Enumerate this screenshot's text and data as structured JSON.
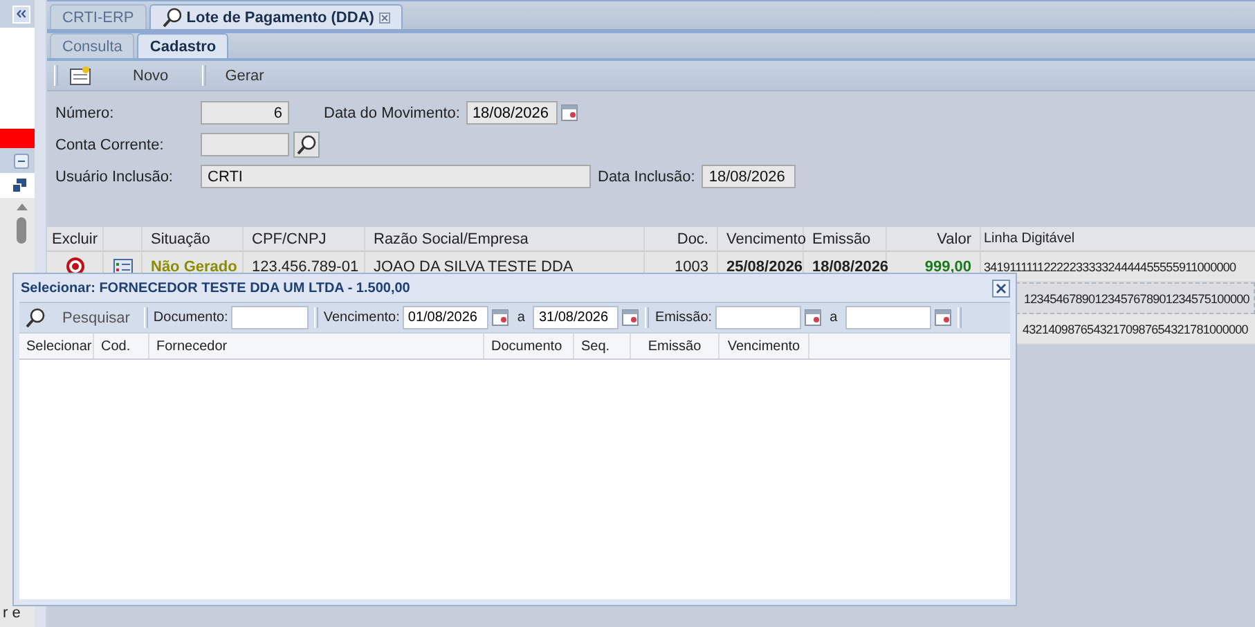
{
  "sidebar": {
    "texts": [
      "r e"
    ]
  },
  "tabs": [
    {
      "label": "CRTI-ERP",
      "selected": false
    },
    {
      "label": "Lote de Pagamento (DDA)",
      "selected": true
    }
  ],
  "subtabs": [
    {
      "label": "Consulta",
      "selected": false
    },
    {
      "label": "Cadastro",
      "selected": true
    }
  ],
  "toolbar": [
    "Novo",
    "Gerar"
  ],
  "form": {
    "numero": {
      "label": "Número:",
      "value": "6"
    },
    "data_movimento": {
      "label": "Data do Movimento:",
      "value": "18/08/2026"
    },
    "conta_corrente": {
      "label": "Conta Corrente:"
    },
    "usuario_inclusao": {
      "label": "Usuário Inclusão:",
      "value": "CRTI"
    },
    "data_inclusao": {
      "label": "Data Inclusão:",
      "value": "18/08/2026"
    }
  },
  "table": {
    "columns": [
      {
        "label": "Excluir"
      },
      {
        "kind": "icon"
      },
      {
        "label": "Situação"
      },
      {
        "label": "CPF/CNPJ"
      },
      {
        "label": "Razão Social/Empresa"
      },
      {
        "label": "Doc."
      },
      {
        "label": "Vencimento"
      },
      {
        "label": "Emissão"
      },
      {
        "label": "Valor"
      },
      {
        "label": "Linha Digitável"
      }
    ],
    "rows": [
      {
        "selected": false,
        "situacao": "Não Gerado",
        "cpf_cnpj": "123.456.789-01",
        "razao_social": "JOAO DA SILVA TESTE DDA",
        "doc": "1003",
        "vencimento": "25/08/2026",
        "emissao": "18/08/2026",
        "valor": "999,00",
        "linha_digitavel": "3419111111222223333324444455555911000000"
      },
      {
        "selected": true,
        "linha_digitavel": "12345467890123457678901234575100000"
      },
      {
        "selected": false,
        "linha_digitavel": "43214098765432170987654321781000000"
      }
    ]
  },
  "dialog": {
    "title": "Selecionar: FORNECEDOR TESTE DDA UM LTDA - 1.500,00",
    "search_button": "Pesquisar",
    "documento": {
      "label": "Documento:"
    },
    "vencimento": {
      "label": "Vencimento:",
      "from": "01/08/2026",
      "to_label": "a",
      "to": "31/08/2026"
    },
    "emissao": {
      "label": "Emissão:",
      "to_label": "a"
    },
    "columns": [
      "Selecionar",
      "Cod.",
      "Fornecedor",
      "Documento",
      "Seq.",
      "Emissão",
      "Vencimento"
    ]
  }
}
